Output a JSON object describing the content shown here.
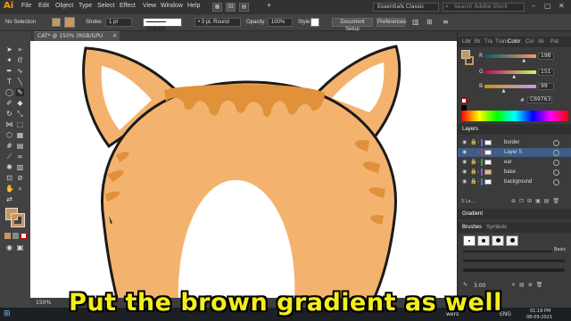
{
  "app": {
    "logo": "Ai"
  },
  "menu": [
    "File",
    "Edit",
    "Object",
    "Type",
    "Select",
    "Effect",
    "View",
    "Window",
    "Help"
  ],
  "workspace": "Essentials Classic",
  "search": {
    "placeholder": "Search Adobe Stock"
  },
  "control": {
    "selection": "No Selection",
    "stroke_label": "Stroke:",
    "stroke_value": "1 pt",
    "uniform": "Uniform",
    "brush": "3 pt. Round",
    "opacity_label": "Opacity:",
    "opacity_value": "100%",
    "style_label": "Style:",
    "document_setup": "Document Setup",
    "preferences": "Preferences"
  },
  "document": {
    "tab_title": "CAT* @ 150% (RGB/GPU Preview)"
  },
  "status": {
    "zoom": "150%"
  },
  "color_panel": {
    "tabs": [
      "Libr",
      "Str",
      "Tra",
      "Trans",
      "Color",
      "Col",
      "Ali",
      "Pat"
    ],
    "active_tab": "Color",
    "channels": [
      {
        "label": "R",
        "value": "198",
        "fraction": 0.78
      },
      {
        "label": "G",
        "value": "151",
        "fraction": 0.59
      },
      {
        "label": "B",
        "value": "99",
        "fraction": 0.39
      }
    ],
    "hex_label": "#",
    "hex": "C69763",
    "fill_color": "#c69763"
  },
  "layers_panel": {
    "title": "Layers",
    "layers": [
      {
        "name": "border",
        "color": "#4a7bd0"
      },
      {
        "name": "Layer 5",
        "color": "#c04040"
      },
      {
        "name": "ear",
        "color": "#3aa74a"
      },
      {
        "name": "base",
        "color": "#8a5fc8"
      },
      {
        "name": "background",
        "color": "#4a7bd0"
      }
    ],
    "footer": "5 La..."
  },
  "gradient_panel": {
    "title": "Gradient"
  },
  "brushes_panel": {
    "tabs": [
      "Brushes",
      "Symbols"
    ],
    "basic_label": "Basic",
    "size_value": "3.00"
  },
  "taskbar": {
    "tray_text": "wers",
    "lang": "ENG",
    "time": "01:19 PM",
    "date": "08-09-2021"
  },
  "subtitle": "Put the brown gradient as well",
  "colors": {
    "fur": "#f3b36e",
    "stripe": "#e0913a",
    "ear_inner": "#ffffff",
    "outline": "#1a1a1a"
  }
}
